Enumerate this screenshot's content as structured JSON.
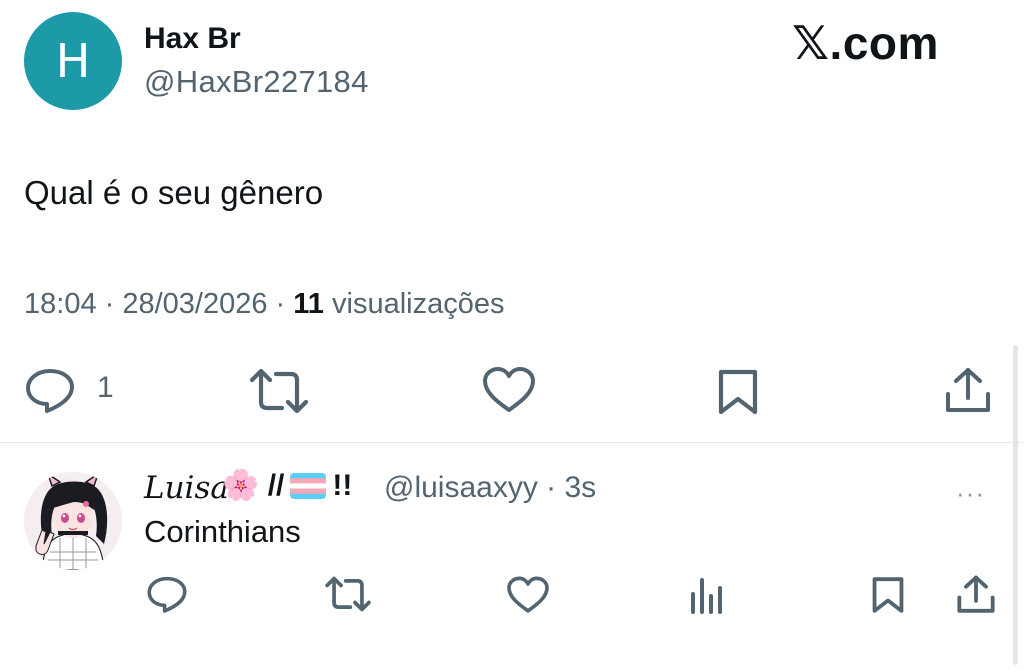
{
  "brand": "𝕏.com",
  "tweet": {
    "avatar_letter": "H",
    "author_name": "Hax Br",
    "author_handle": "@HaxBr227184",
    "text": "Qual é o seu gênero",
    "time": "18:04 · 28/03/2026 · ",
    "views_count": "11",
    "views_label": " visualizações",
    "reply_count": "1"
  },
  "reply": {
    "author_name": "Luisa",
    "badges": "🌸 //",
    "badges_end": "!!",
    "author_handle": "@luisaaxyy · 3s",
    "more": "···",
    "text": "Corinthians"
  },
  "icons": {
    "reply": "reply-icon",
    "retweet": "retweet-icon",
    "like": "heart-icon",
    "bookmark": "bookmark-icon",
    "share": "share-icon",
    "views": "analytics-icon"
  },
  "colors": {
    "avatar_bg": "#1d9aa8",
    "secondary_text": "#536471",
    "primary_text": "#0f1419"
  }
}
